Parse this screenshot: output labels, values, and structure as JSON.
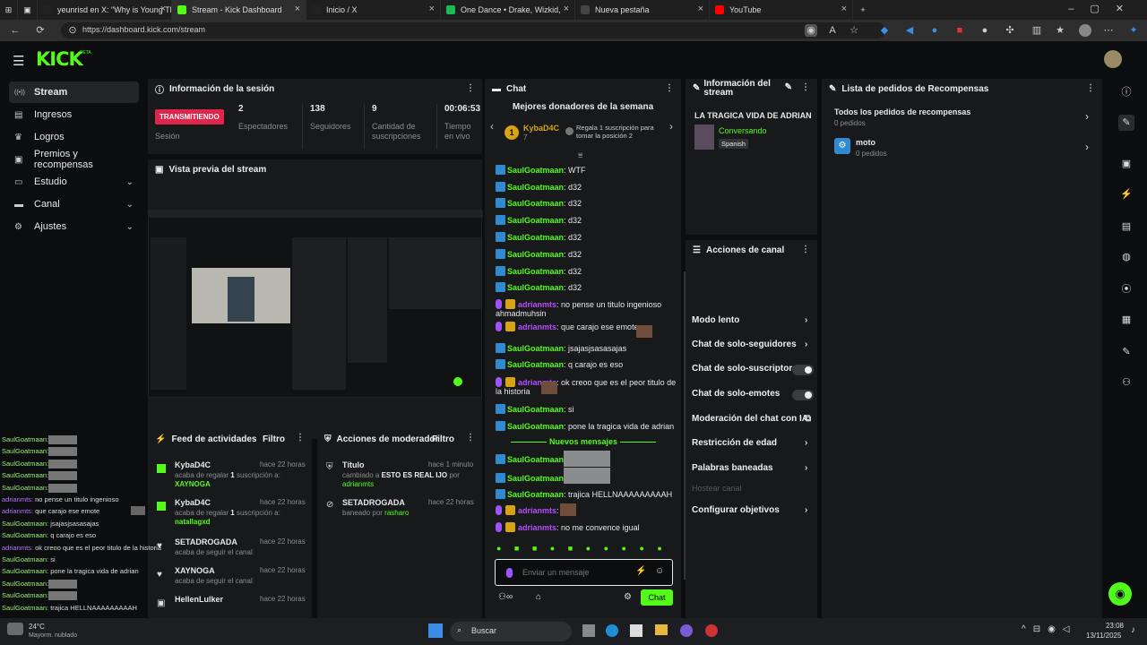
{
  "browser": {
    "tabs": [
      {
        "label": "yeunrisd en X: \"Why is Young Th",
        "color": "#222"
      },
      {
        "label": "Stream - Kick Dashboard",
        "color": "#53fc18"
      },
      {
        "label": "Inicio / X",
        "color": "#222"
      },
      {
        "label": "One Dance • Drake, Wizkid,",
        "color": "#1db954"
      },
      {
        "label": "Nueva pestaña",
        "color": "#444"
      },
      {
        "label": "YouTube",
        "color": "#ff0000"
      }
    ],
    "url": "https://dashboard.kick.com/stream"
  },
  "brand": {
    "logo": "KICK",
    "beta": "BETA"
  },
  "sidebar": {
    "items": [
      {
        "label": "Stream",
        "icon": "stream-icon",
        "expand": false
      },
      {
        "label": "Ingresos",
        "icon": "wallet-icon",
        "expand": false
      },
      {
        "label": "Logros",
        "icon": "trophy-icon",
        "expand": false
      },
      {
        "label": "Premios y recompensas",
        "icon": "gift-icon",
        "expand": false
      },
      {
        "label": "Estudio",
        "icon": "monitor-icon",
        "expand": true
      },
      {
        "label": "Canal",
        "icon": "channel-icon",
        "expand": true
      },
      {
        "label": "Ajustes",
        "icon": "gear-icon",
        "expand": true
      }
    ]
  },
  "session": {
    "title": "Información de la sesión",
    "status": "TRANSMITIENDO",
    "status_label": "Sesión",
    "stats": [
      {
        "value": "2",
        "label": "Espectadores"
      },
      {
        "value": "138",
        "label": "Seguidores"
      },
      {
        "value": "9",
        "label": "Cantidad de suscripciones"
      },
      {
        "value": "00:06:53",
        "label": "Tiempo en vivo"
      }
    ]
  },
  "preview": {
    "title": "Vista previa del stream"
  },
  "feed": {
    "title": "Feed de actividades",
    "filter": "Filtro",
    "items": [
      {
        "user": "KybaD4C",
        "time": "hace 22 horas",
        "pre": "acaba de regalar ",
        "num": "1",
        "post": " suscripción a:",
        "target": "XAYNOGA"
      },
      {
        "user": "KybaD4C",
        "time": "hace 22 horas",
        "pre": "acaba de regalar ",
        "num": "1",
        "post": " suscripción a:",
        "target": "natallagxd"
      },
      {
        "user": "SETADROGADA",
        "time": "hace 22 horas",
        "pre": "acaba de seguir el canal",
        "num": "",
        "post": "",
        "target": ""
      },
      {
        "user": "XAYNOGA",
        "time": "hace 22 horas",
        "pre": "acaba de seguir el canal",
        "num": "",
        "post": "",
        "target": ""
      },
      {
        "user": "HellenLulker",
        "time": "hace 22 horas",
        "pre": "",
        "num": "",
        "post": "",
        "target": ""
      }
    ]
  },
  "mod": {
    "title": "Acciones de moderador",
    "filter": "Filtro",
    "items": [
      {
        "title": "Título",
        "time": "hace 1 minuto",
        "pre": "cambiado a ",
        "bold": "ESTO ES REAL IJO",
        "mid": " por",
        "user": "adrianmts"
      },
      {
        "title": "SETADROGADA",
        "time": "hace 22 horas",
        "pre": "baneado por ",
        "bold": "",
        "mid": "",
        "user": "rasharo"
      }
    ]
  },
  "chat": {
    "title": "Chat",
    "donors_title": "Mejores donadores de la semana",
    "donor_rank": "1",
    "donor_name": "KybaD4C",
    "donor_count": "7",
    "gift_text": "Regala 1 suscripción para tomar la posición 2",
    "messages": [
      {
        "user": "SaulGoatmaan",
        "text": ": WTF",
        "kind": "g"
      },
      {
        "user": "SaulGoatmaan",
        "text": ": d32",
        "kind": "g"
      },
      {
        "user": "SaulGoatmaan",
        "text": ": d32",
        "kind": "g"
      },
      {
        "user": "SaulGoatmaan",
        "text": ": d32",
        "kind": "g"
      },
      {
        "user": "SaulGoatmaan",
        "text": ": d32",
        "kind": "g"
      },
      {
        "user": "SaulGoatmaan",
        "text": ": d32",
        "kind": "g"
      },
      {
        "user": "SaulGoatmaan",
        "text": ": d32",
        "kind": "g"
      },
      {
        "user": "SaulGoatmaan",
        "text": ": d32",
        "kind": "g"
      },
      {
        "user": "adrianmts",
        "text": ": no pense un titulo ingenioso",
        "kind": "p",
        "line2": "ahmadmuhsin"
      },
      {
        "user": "adrianmts",
        "text": ": que carajo ese emote",
        "kind": "p"
      },
      {
        "user": "SaulGoatmaan",
        "text": ": jsajasjsasasajas",
        "kind": "g"
      },
      {
        "user": "SaulGoatmaan",
        "text": ": q carajo es eso",
        "kind": "g"
      },
      {
        "user": "adrianmts",
        "text": ": ok creoo que es el peor titulo de",
        "kind": "p",
        "line2": "la historia"
      },
      {
        "user": "SaulGoatmaan",
        "text": ": si",
        "kind": "g"
      },
      {
        "user": "SaulGoatmaan",
        "text": ": pone la tragica vida de adrian",
        "kind": "g"
      }
    ],
    "new_label": "Nuevos mensajes",
    "new_messages": [
      {
        "user": "SaulGoatmaan",
        "text": ":",
        "kind": "g"
      },
      {
        "user": "SaulGoatmaan",
        "text": ":",
        "kind": "g"
      },
      {
        "user": "SaulGoatmaan",
        "text": ": trajica HELLNAAAAAAAAAH",
        "kind": "g"
      },
      {
        "user": "adrianmts",
        "text": ":",
        "kind": "p"
      },
      {
        "user": "adrianmts",
        "text": ": no me convence igual",
        "kind": "p"
      }
    ],
    "input_placeholder": "Enviar un mensaje",
    "send_label": "Chat"
  },
  "stream_info": {
    "title": "Información del stream",
    "stream_title": "LA TRAGICA VIDA DE ADRIAN",
    "category": "Conversando",
    "language": "Spanish"
  },
  "channel_actions": {
    "title": "Acciones de canal",
    "items": [
      {
        "label": "Modo lento",
        "type": "chevron"
      },
      {
        "label": "Chat de solo-seguidores",
        "type": "chevron"
      },
      {
        "label": "Chat de solo-suscriptores",
        "type": "toggle"
      },
      {
        "label": "Chat de solo-emotes",
        "type": "toggle"
      },
      {
        "label": "Moderación del chat con IA",
        "type": "external"
      },
      {
        "label": "Restricción de edad",
        "type": "chevron"
      },
      {
        "label": "Palabras baneadas",
        "type": "chevron"
      },
      {
        "label": "Hostear canal",
        "type": "disabled"
      },
      {
        "label": "Configurar objetivos",
        "type": "chevron"
      }
    ]
  },
  "rewards": {
    "title": "Lista de pedidos de Recompensas",
    "all_label": "Todos los pedidos de recompensas",
    "all_count": "0 pedidos",
    "reward_name": "moto",
    "reward_count": "0 pedidos"
  },
  "overlay_chat": [
    {
      "u": "SaulGoatmaan:",
      "t": "",
      "img": true
    },
    {
      "u": "SaulGoatmaan:",
      "t": "",
      "img": true
    },
    {
      "u": "SaulGoatmaan:",
      "t": "",
      "img": true
    },
    {
      "u": "SaulGoatmaan:",
      "t": "",
      "img": true
    },
    {
      "u": "SaulGoatmaan:",
      "t": "",
      "img": true
    },
    {
      "u": "adrianmts:",
      "t": " no pense un titulo ingenioso",
      "img": false,
      "p": true
    },
    {
      "u": "adrianmts:",
      "t": " que carajo ese emote",
      "img": false,
      "p": true
    },
    {
      "u": "SaulGoatmaan:",
      "t": " jsajasjsasasajas",
      "img": false
    },
    {
      "u": "SaulGoatmaan:",
      "t": " q carajo es eso",
      "img": false
    },
    {
      "u": "adrianmts:",
      "t": " ok creoo que es el peor titulo de la historia",
      "img": false,
      "p": true
    },
    {
      "u": "SaulGoatmaan:",
      "t": " si",
      "img": false
    },
    {
      "u": "SaulGoatmaan:",
      "t": " pone la tragica vida de adrian",
      "img": false
    },
    {
      "u": "SaulGoatmaan:",
      "t": "",
      "img": true
    },
    {
      "u": "SaulGoatmaan:",
      "t": "",
      "img": true
    },
    {
      "u": "SaulGoatmaan:",
      "t": " trajica HELLNAAAAAAAAAH",
      "img": false
    }
  ],
  "taskbar": {
    "weather_temp": "24°C",
    "weather_text": "Mayorm. nublado",
    "search": "Buscar",
    "time": "23:08",
    "date": "13/11/2025"
  }
}
